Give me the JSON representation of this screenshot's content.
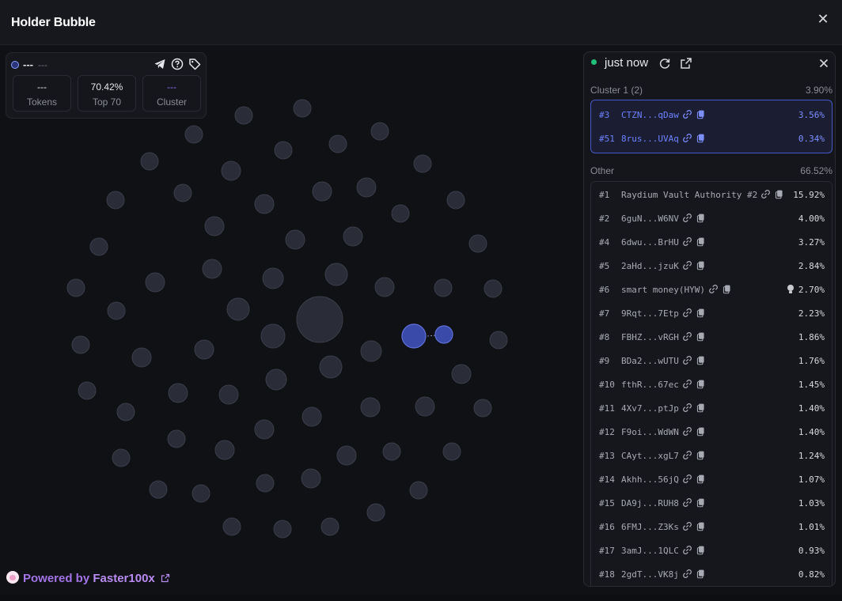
{
  "window": {
    "title": "Holder Bubble"
  },
  "token_card": {
    "name": "---",
    "symbol": "---",
    "stats": [
      {
        "value": "---",
        "label": "Tokens"
      },
      {
        "value": "70.42%",
        "label": "Top 70"
      },
      {
        "value": "---",
        "label": "Cluster"
      }
    ]
  },
  "panel": {
    "updated": "just now",
    "clusters": [
      {
        "label": "Cluster 1 (2)",
        "percent": "3.90%",
        "holders": [
          {
            "rank": "#3",
            "address": "CTZN...qDaw",
            "percent": "3.56%"
          },
          {
            "rank": "#51",
            "address": "8rus...UVAq",
            "percent": "0.34%"
          }
        ]
      }
    ],
    "other": {
      "label": "Other",
      "percent": "66.52%",
      "holders": [
        {
          "rank": "#1",
          "address": "Raydium Vault Authority #2",
          "percent": "15.92%"
        },
        {
          "rank": "#2",
          "address": "6guN...W6NV",
          "percent": "4.00%"
        },
        {
          "rank": "#4",
          "address": "6dwu...BrHU",
          "percent": "3.27%"
        },
        {
          "rank": "#5",
          "address": "2aHd...jzuK",
          "percent": "2.84%"
        },
        {
          "rank": "#6",
          "address": "smart money(HYW)",
          "percent": "2.70%",
          "bulb": true
        },
        {
          "rank": "#7",
          "address": "9Rqt...7Etp",
          "percent": "2.23%"
        },
        {
          "rank": "#8",
          "address": "FBHZ...vRGH",
          "percent": "1.86%"
        },
        {
          "rank": "#9",
          "address": "BDa2...wUTU",
          "percent": "1.76%"
        },
        {
          "rank": "#10",
          "address": "fthR...67ec",
          "percent": "1.45%"
        },
        {
          "rank": "#11",
          "address": "4Xv7...ptJp",
          "percent": "1.40%"
        },
        {
          "rank": "#12",
          "address": "F9oi...WdWN",
          "percent": "1.40%"
        },
        {
          "rank": "#13",
          "address": "CAyt...xgL7",
          "percent": "1.24%"
        },
        {
          "rank": "#14",
          "address": "Akhh...56jQ",
          "percent": "1.07%"
        },
        {
          "rank": "#15",
          "address": "DA9j...RUH8",
          "percent": "1.03%"
        },
        {
          "rank": "#16",
          "address": "6FMJ...Z3Ks",
          "percent": "1.01%"
        },
        {
          "rank": "#17",
          "address": "3amJ...1QLC",
          "percent": "0.93%"
        },
        {
          "rank": "#18",
          "address": "2gdT...VK8j",
          "percent": "0.82%"
        }
      ]
    }
  },
  "footer": {
    "powered_prefix": "Powered by",
    "brand": "Faster100x"
  },
  "colors": {
    "accent": "#6d82ff",
    "live": "#22c07a",
    "brand": "#b98cf5",
    "bubble": "#2b2f3b"
  }
}
